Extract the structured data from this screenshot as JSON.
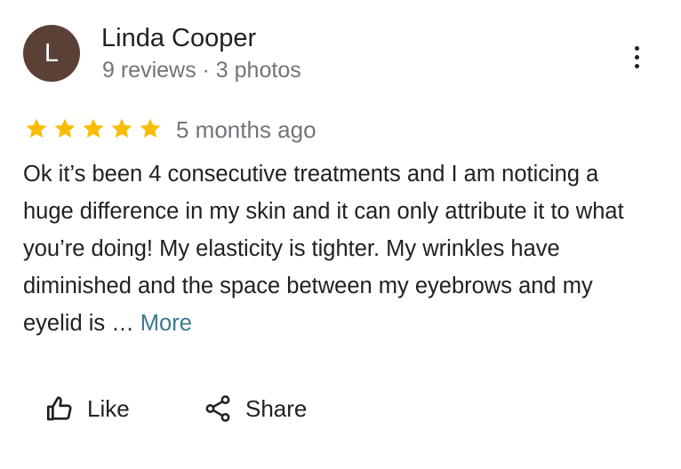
{
  "review": {
    "avatar_letter": "L",
    "author_name": "Linda Cooper",
    "author_meta": "9 reviews · 3 photos",
    "rating": 5,
    "rating_max": 5,
    "date": "5 months ago",
    "text": "Ok it’s been 4 consecutive treatments and I am noticing a huge difference in my skin and it can only attribute it to what you’re doing! My elasticity is tighter. My wrinkles have diminished and the space between my eyebrows and my eyelid is … ",
    "more_label": "More"
  },
  "actions": {
    "like_label": "Like",
    "share_label": "Share"
  },
  "icons": {
    "more_options": "vertical-dots-icon",
    "star": "star-icon",
    "like": "thumbs-up-icon",
    "share": "share-icon"
  },
  "colors": {
    "avatar_bg": "#5b4037",
    "star": "#fbbc04",
    "more_link": "#3a7a8f",
    "meta_text": "#70757a",
    "primary_text": "#202124"
  }
}
